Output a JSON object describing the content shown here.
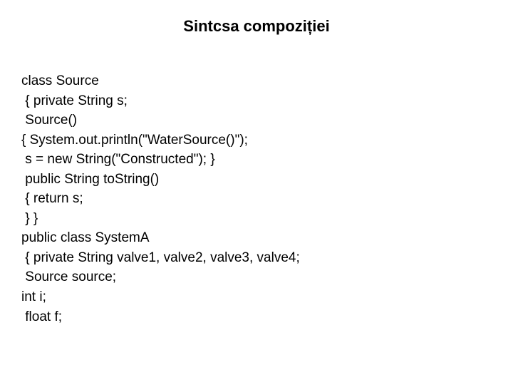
{
  "title": "Sintcsa compoziției",
  "code": {
    "lines": [
      "class Source",
      " { private String s;",
      " Source()",
      "{ System.out.println(\"WaterSource()\");",
      " s = new String(\"Constructed\"); }",
      " public String toString()",
      " { return s;",
      " } }",
      "public class SystemA",
      " { private String valve1, valve2, valve3, valve4;",
      " Source source;",
      "int i;",
      " float f;"
    ]
  }
}
